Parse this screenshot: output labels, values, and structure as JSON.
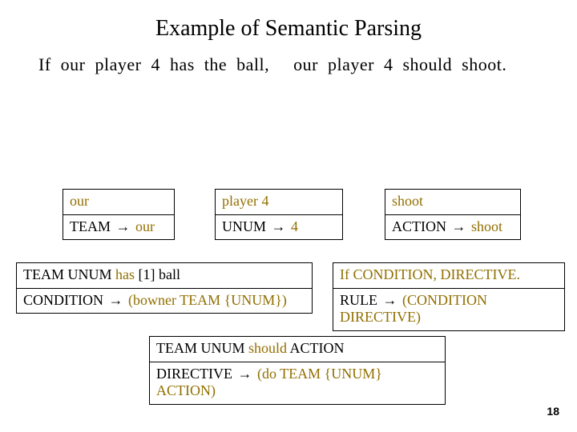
{
  "title": "Example of Semantic Parsing",
  "sentence": {
    "w0": "If",
    "w1": "our",
    "w2": "player",
    "w3": "4",
    "w4": "has",
    "w5": "the",
    "w6": "ball,",
    "w7": "our",
    "w8": "player",
    "w9": "4",
    "w10": "should",
    "w11": "shoot."
  },
  "box_our": {
    "top": "our",
    "bot_lhs": "TEAM",
    "bot_arrow": "→",
    "bot_rhs": "our"
  },
  "box_player4": {
    "top": "player 4",
    "bot_lhs": "UNUM",
    "bot_arrow": "→",
    "bot_rhs": "4"
  },
  "box_shoot": {
    "top": "shoot",
    "bot_lhs": "ACTION",
    "bot_arrow": "→",
    "bot_rhs": "shoot"
  },
  "box_condition": {
    "top_pre": "TEAM UNUM",
    "top_has": "has",
    "top_post": "[1] ball",
    "bot_lhs": "CONDITION",
    "bot_arrow": "→",
    "bot_rhs": "(bowner TEAM {UNUM})"
  },
  "box_rule": {
    "top": "If CONDITION, DIRECTIVE.",
    "bot_lhs": "RULE",
    "bot_arrow": "→",
    "bot_rhs": "(CONDITION DIRECTIVE)"
  },
  "box_directive": {
    "top_pre": "TEAM UNUM",
    "top_should": "should",
    "top_post": "ACTION",
    "bot_lhs": "DIRECTIVE",
    "bot_arrow": "→",
    "bot_rhs": "(do TEAM {UNUM} ACTION)"
  },
  "page_number": "18"
}
